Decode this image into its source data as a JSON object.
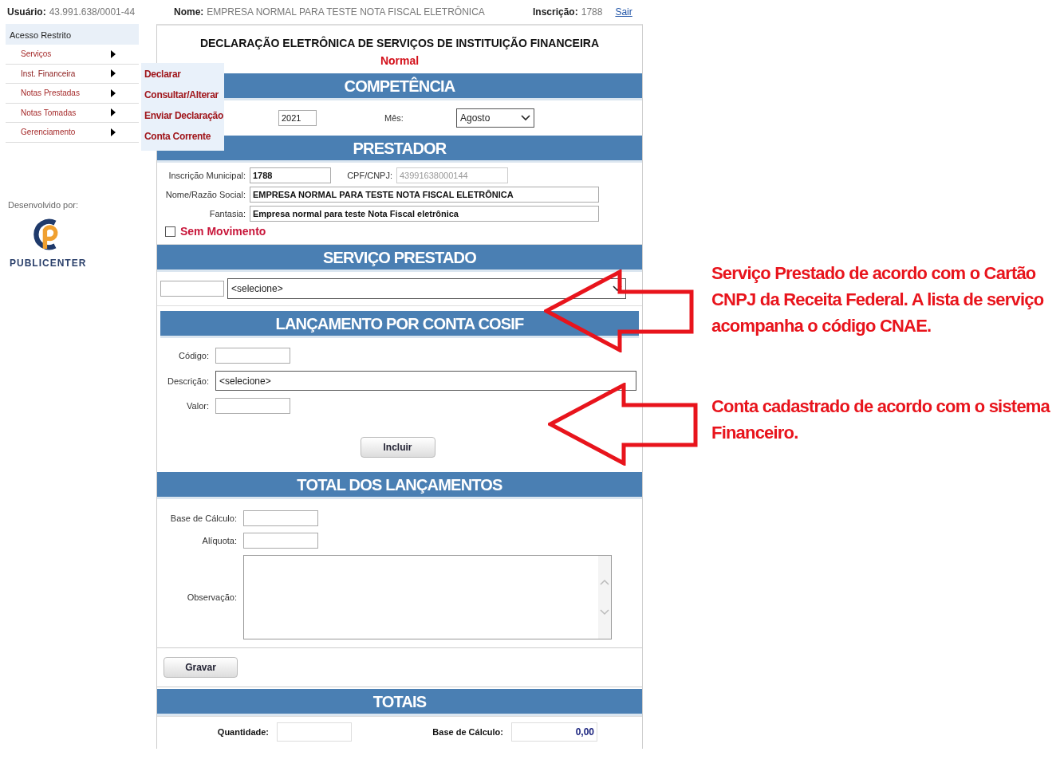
{
  "header": {
    "user_label": "Usuário:",
    "user_value": "43.991.638/0001-44",
    "name_label": "Nome:",
    "name_value": "EMPRESA NORMAL PARA TESTE NOTA FISCAL ELETRÔNICA",
    "reg_label": "Inscrição:",
    "reg_value": "1788",
    "logout": "Sair"
  },
  "sidebar": {
    "title": "Acesso Restrito",
    "items": [
      {
        "label": "Serviços",
        "expanded": false
      },
      {
        "label": "Inst. Financeira",
        "expanded": true,
        "children": [
          {
            "label": "Declarar"
          },
          {
            "label": "Consultar/Alterar"
          },
          {
            "label": "Enviar Declaração"
          },
          {
            "label": "Conta Corrente"
          }
        ]
      },
      {
        "label": "Notas Prestadas",
        "expanded": false
      },
      {
        "label": "Notas Tomadas",
        "expanded": false
      },
      {
        "label": "Gerenciamento",
        "expanded": false
      }
    ]
  },
  "credit": {
    "label": "Desenvolvido por:",
    "brand": "PUBLICENTER"
  },
  "form": {
    "title": "DECLARAÇÃO ELETRÔNICA DE SERVIÇOS DE INSTITUIÇÃO FINANCEIRA",
    "subtitle": "Normal",
    "competencia": {
      "title": "COMPETÊNCIA",
      "year": "2021",
      "month_label": "Mês:",
      "month": "Agosto"
    },
    "prestador": {
      "title": "PRESTADOR",
      "im_label": "Inscrição Municipal:",
      "im_value": "1788",
      "cnpj_label": "CPF/CNPJ:",
      "cnpj_value": "43991638000144",
      "name_label": "Nome/Razão Social:",
      "name_value": "EMPRESA NORMAL PARA TESTE NOTA FISCAL ELETRÔNICA",
      "fantasia_label": "Fantasia:",
      "fantasia_value": "Empresa normal para teste Nota Fiscal eletrônica",
      "no_movement": {
        "label": "Sem Movimento",
        "checked": false
      }
    },
    "servico": {
      "title": "SERVIÇO PRESTADO",
      "select": "<selecione>"
    },
    "lancamento": {
      "title": "LANÇAMENTO POR CONTA COSIF",
      "code_label": "Código:",
      "desc_label": "Descrição:",
      "desc_value": "<selecione>",
      "value_label": "Valor:",
      "button": "Incluir"
    },
    "total": {
      "title": "TOTAL DOS LANÇAMENTOS",
      "base_label": "Base de Cálculo:",
      "rate_label": "Alíquota:",
      "notes_label": "Observação:"
    },
    "save_button": "Gravar",
    "totais": {
      "title": "TOTAIS",
      "qty_label": "Quantidade:",
      "base_label": "Base de Cálculo:",
      "base_value": "0,00"
    }
  },
  "annotations": [
    {
      "text": "Serviço Prestado de acordo com o Cartão CNPJ da Receita Federal. A lista de serviço acompanha o código CNAE."
    },
    {
      "text": "Conta cadastrado de acordo com o sistema Financeiro."
    }
  ]
}
